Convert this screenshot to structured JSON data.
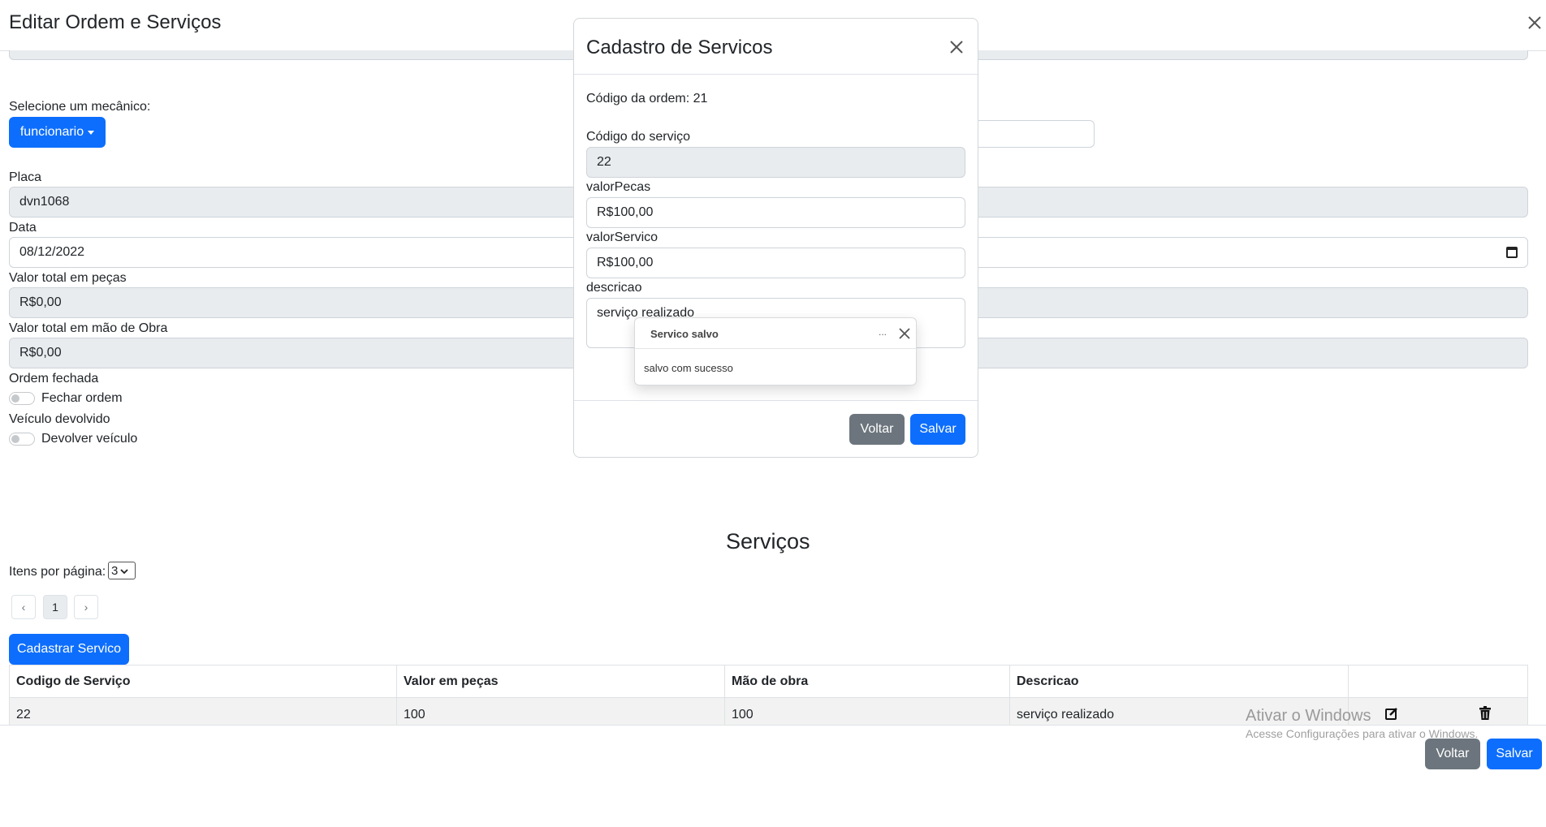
{
  "page": {
    "title": "Editar Ordem e Serviços",
    "mechanic_label": "Selecione um mecânico:",
    "mechanic_button": "funcionario",
    "placa_label": "Placa",
    "placa_value": "dvn1068",
    "data_label": "Data",
    "data_value": "08/12/2022",
    "pecas_label": "Valor total em peças",
    "pecas_value": "R$0,00",
    "obra_label": "Valor total em mão de Obra",
    "obra_value": "R$0,00",
    "ordem_fechada_label": "Ordem fechada",
    "fechar_ordem_label": "Fechar ordem",
    "veiculo_devolvido_label": "Veículo devolvido",
    "devolver_veiculo_label": "Devolver veículo"
  },
  "services": {
    "heading": "Serviços",
    "per_page_label": "Itens por página:",
    "per_page_value": "3",
    "current_page": "1",
    "add_button": "Cadastrar Servico",
    "columns": [
      "Codigo de Serviço",
      "Valor em peças",
      "Mão de obra",
      "Descricao"
    ],
    "rows": [
      [
        "22",
        "100",
        "100",
        "serviço realizado"
      ]
    ]
  },
  "footer": {
    "back_button": "Voltar",
    "save_button": "Salvar"
  },
  "modal": {
    "title": "Cadastro de Servicos",
    "order_code": "Código da ordem: 21",
    "service_code_label": "Código do serviço",
    "service_code_value": "22",
    "valor_pecas_label": "valorPecas",
    "valor_pecas_value": "R$100,00",
    "valor_servico_label": "valorServico",
    "valor_servico_value": "R$100,00",
    "descricao_label": "descricao",
    "descricao_value": "serviço realizado",
    "back_button": "Voltar",
    "save_button": "Salvar"
  },
  "toast": {
    "title": "Servico salvo",
    "ellipsis": "...",
    "body": "salvo com sucesso"
  },
  "watermark": {
    "title": "Ativar o Windows",
    "subtitle": "Acesse Configurações para ativar o Windows."
  },
  "colors": {
    "primary": "#0d6efd",
    "secondary": "#6c757d",
    "readonly": "#e9ecef"
  }
}
